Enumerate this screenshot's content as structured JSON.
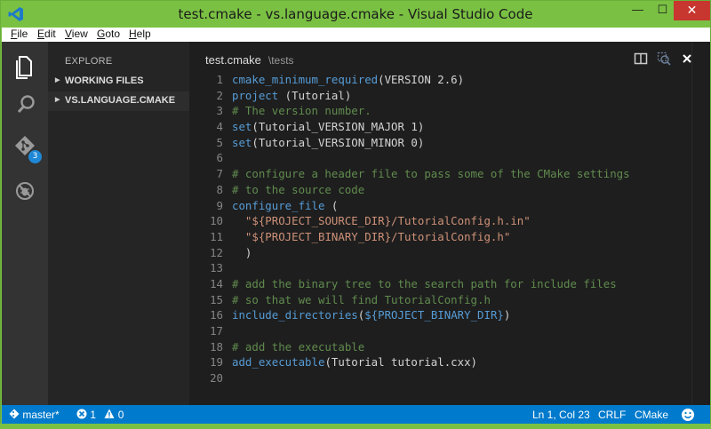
{
  "window": {
    "title": "test.cmake - vs.language.cmake - Visual Studio Code",
    "minimize_glyph": "—",
    "maximize_glyph": "☐",
    "close_glyph": "✕"
  },
  "menu": {
    "file": {
      "u": "F",
      "rest": "ile"
    },
    "edit": {
      "u": "E",
      "rest": "dit"
    },
    "view": {
      "u": "V",
      "rest": "iew"
    },
    "goto": {
      "u": "G",
      "rest": "oto"
    },
    "help": {
      "u": "H",
      "rest": "elp"
    }
  },
  "activity": {
    "items": [
      {
        "name": "explorer-icon",
        "active": true
      },
      {
        "name": "search-icon",
        "active": false
      },
      {
        "name": "git-icon",
        "active": false,
        "badge": "3"
      },
      {
        "name": "debug-icon",
        "active": false
      }
    ]
  },
  "sidebar": {
    "header": "EXPLORE",
    "sections": [
      {
        "label": "WORKING FILES",
        "arrow": "▶"
      },
      {
        "label": "VS.LANGUAGE.CMAKE",
        "arrow": "▶"
      }
    ]
  },
  "editor": {
    "file_name": "test.cmake",
    "file_path": "\\tests",
    "lines": [
      [
        [
          "fn",
          "cmake_minimum_required"
        ],
        [
          "pl",
          "(VERSION 2.6)"
        ]
      ],
      [
        [
          "fn",
          "project"
        ],
        [
          "pl",
          " (Tutorial)"
        ]
      ],
      [
        [
          "cm",
          "# The version number."
        ]
      ],
      [
        [
          "fn",
          "set"
        ],
        [
          "pl",
          "(Tutorial_VERSION_MAJOR 1)"
        ]
      ],
      [
        [
          "fn",
          "set"
        ],
        [
          "pl",
          "(Tutorial_VERSION_MINOR 0)"
        ]
      ],
      [],
      [
        [
          "cm",
          "# configure a header file to pass some of the CMake settings"
        ]
      ],
      [
        [
          "cm",
          "# to the source code"
        ]
      ],
      [
        [
          "fn",
          "configure_file"
        ],
        [
          "pl",
          " ("
        ]
      ],
      [
        [
          "pl",
          "  "
        ],
        [
          "str",
          "\"${PROJECT_SOURCE_DIR}/TutorialConfig.h.in\""
        ]
      ],
      [
        [
          "pl",
          "  "
        ],
        [
          "str",
          "\"${PROJECT_BINARY_DIR}/TutorialConfig.h\""
        ]
      ],
      [
        [
          "pl",
          "  )"
        ]
      ],
      [],
      [
        [
          "cm",
          "# add the binary tree to the search path for include files"
        ]
      ],
      [
        [
          "cm",
          "# so that we will find TutorialConfig.h"
        ]
      ],
      [
        [
          "fn",
          "include_directories"
        ],
        [
          "pl",
          "("
        ],
        [
          "fn",
          "${PROJECT_BINARY_DIR}"
        ],
        [
          "pl",
          ")"
        ]
      ],
      [],
      [
        [
          "cm",
          "# add the executable"
        ]
      ],
      [
        [
          "fn",
          "add_executable"
        ],
        [
          "pl",
          "(Tutorial tutorial.cxx)"
        ]
      ],
      []
    ]
  },
  "status": {
    "branch": "master*",
    "errors": "1",
    "warnings": "0",
    "position": "Ln 1, Col 23",
    "eol": "CRLF",
    "language": "CMake"
  },
  "colors": {
    "frame": "#7ac143",
    "statusbar": "#007acc",
    "keyword": "#569cd6",
    "comment": "#608b4e",
    "string": "#ce9178"
  }
}
